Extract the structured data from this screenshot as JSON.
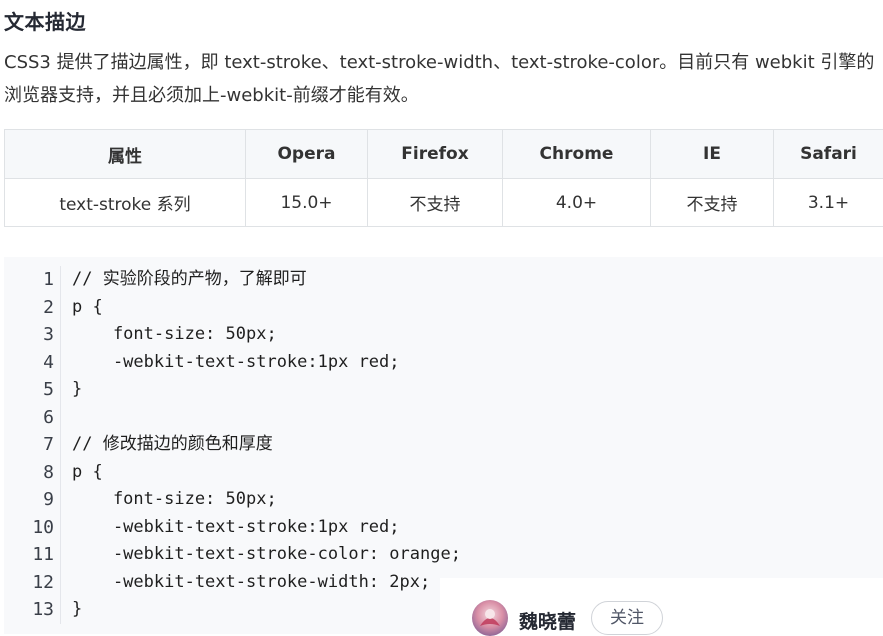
{
  "article": {
    "heading": "文本描边",
    "paragraph": "CSS3 提供了描边属性，即 text-stroke、text-stroke-width、text-stroke-color。目前只有 webkit 引擎的浏览器支持，并且必须加上-webkit-前缀才能有效。"
  },
  "compat_table": {
    "headers": [
      "属性",
      "Opera",
      "Firefox",
      "Chrome",
      "IE",
      "Safari"
    ],
    "rows": [
      [
        "text-stroke 系列",
        "15.0+",
        "不支持",
        "4.0+",
        "不支持",
        "3.1+"
      ]
    ]
  },
  "code_block": {
    "line_numbers": [
      "1",
      "2",
      "3",
      "4",
      "5",
      "6",
      "7",
      "8",
      "9",
      "10",
      "11",
      "12",
      "13"
    ],
    "lines": [
      "// 实验阶段的产物，了解即可",
      "p {",
      "    font-size: 50px;",
      "    -webkit-text-stroke:1px red;",
      "}",
      "",
      "// 修改描边的颜色和厚度",
      "p {",
      "    font-size: 50px;",
      "    -webkit-text-stroke:1px red;",
      "    -webkit-text-stroke-color: orange;",
      "    -webkit-text-stroke-width: 2px;",
      "}"
    ]
  },
  "author": {
    "name": "魏晓蕾",
    "follow_label": "关注",
    "avatar_icon": "user-avatar"
  }
}
